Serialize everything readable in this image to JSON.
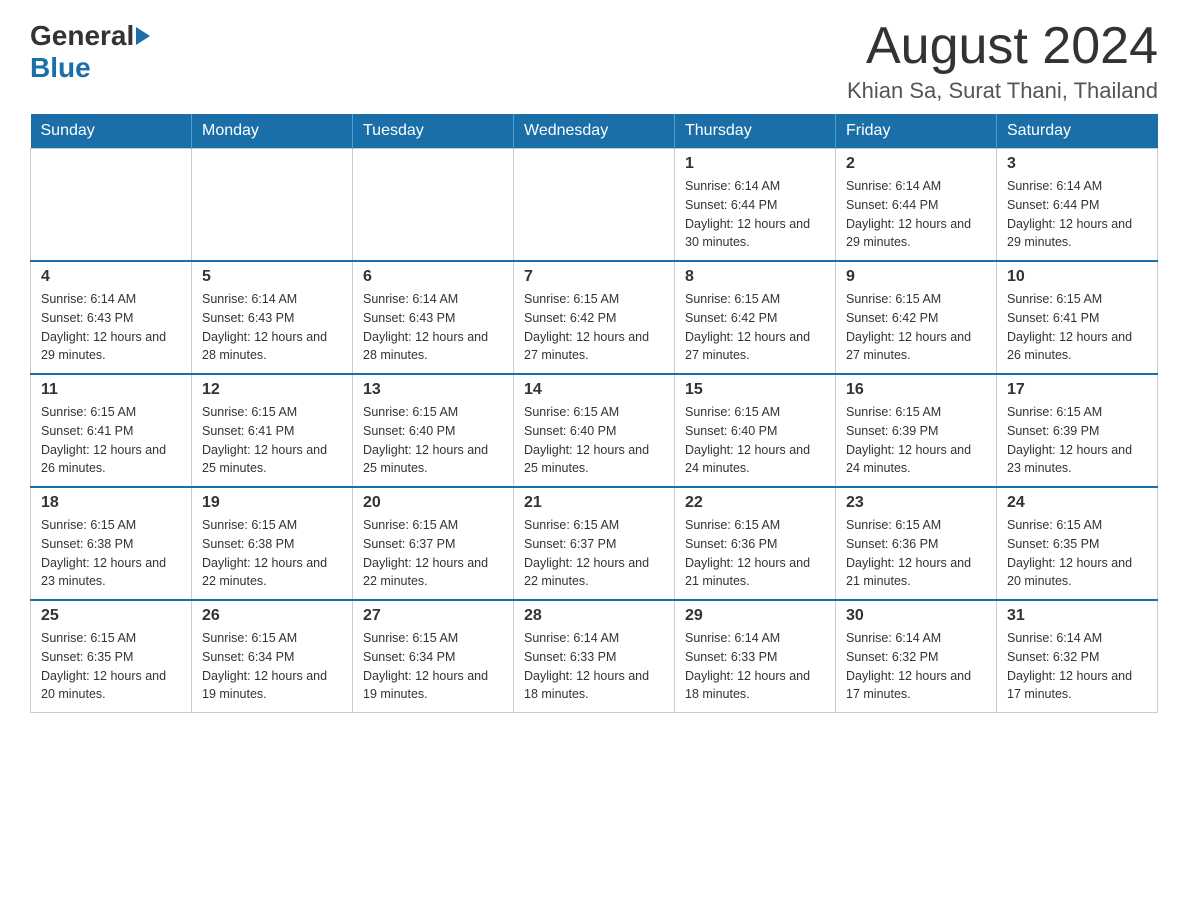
{
  "logo": {
    "general": "General",
    "blue": "Blue"
  },
  "title": "August 2024",
  "location": "Khian Sa, Surat Thani, Thailand",
  "days_of_week": [
    "Sunday",
    "Monday",
    "Tuesday",
    "Wednesday",
    "Thursday",
    "Friday",
    "Saturday"
  ],
  "weeks": [
    [
      {
        "day": "",
        "info": ""
      },
      {
        "day": "",
        "info": ""
      },
      {
        "day": "",
        "info": ""
      },
      {
        "day": "",
        "info": ""
      },
      {
        "day": "1",
        "info": "Sunrise: 6:14 AM\nSunset: 6:44 PM\nDaylight: 12 hours and 30 minutes."
      },
      {
        "day": "2",
        "info": "Sunrise: 6:14 AM\nSunset: 6:44 PM\nDaylight: 12 hours and 29 minutes."
      },
      {
        "day": "3",
        "info": "Sunrise: 6:14 AM\nSunset: 6:44 PM\nDaylight: 12 hours and 29 minutes."
      }
    ],
    [
      {
        "day": "4",
        "info": "Sunrise: 6:14 AM\nSunset: 6:43 PM\nDaylight: 12 hours and 29 minutes."
      },
      {
        "day": "5",
        "info": "Sunrise: 6:14 AM\nSunset: 6:43 PM\nDaylight: 12 hours and 28 minutes."
      },
      {
        "day": "6",
        "info": "Sunrise: 6:14 AM\nSunset: 6:43 PM\nDaylight: 12 hours and 28 minutes."
      },
      {
        "day": "7",
        "info": "Sunrise: 6:15 AM\nSunset: 6:42 PM\nDaylight: 12 hours and 27 minutes."
      },
      {
        "day": "8",
        "info": "Sunrise: 6:15 AM\nSunset: 6:42 PM\nDaylight: 12 hours and 27 minutes."
      },
      {
        "day": "9",
        "info": "Sunrise: 6:15 AM\nSunset: 6:42 PM\nDaylight: 12 hours and 27 minutes."
      },
      {
        "day": "10",
        "info": "Sunrise: 6:15 AM\nSunset: 6:41 PM\nDaylight: 12 hours and 26 minutes."
      }
    ],
    [
      {
        "day": "11",
        "info": "Sunrise: 6:15 AM\nSunset: 6:41 PM\nDaylight: 12 hours and 26 minutes."
      },
      {
        "day": "12",
        "info": "Sunrise: 6:15 AM\nSunset: 6:41 PM\nDaylight: 12 hours and 25 minutes."
      },
      {
        "day": "13",
        "info": "Sunrise: 6:15 AM\nSunset: 6:40 PM\nDaylight: 12 hours and 25 minutes."
      },
      {
        "day": "14",
        "info": "Sunrise: 6:15 AM\nSunset: 6:40 PM\nDaylight: 12 hours and 25 minutes."
      },
      {
        "day": "15",
        "info": "Sunrise: 6:15 AM\nSunset: 6:40 PM\nDaylight: 12 hours and 24 minutes."
      },
      {
        "day": "16",
        "info": "Sunrise: 6:15 AM\nSunset: 6:39 PM\nDaylight: 12 hours and 24 minutes."
      },
      {
        "day": "17",
        "info": "Sunrise: 6:15 AM\nSunset: 6:39 PM\nDaylight: 12 hours and 23 minutes."
      }
    ],
    [
      {
        "day": "18",
        "info": "Sunrise: 6:15 AM\nSunset: 6:38 PM\nDaylight: 12 hours and 23 minutes."
      },
      {
        "day": "19",
        "info": "Sunrise: 6:15 AM\nSunset: 6:38 PM\nDaylight: 12 hours and 22 minutes."
      },
      {
        "day": "20",
        "info": "Sunrise: 6:15 AM\nSunset: 6:37 PM\nDaylight: 12 hours and 22 minutes."
      },
      {
        "day": "21",
        "info": "Sunrise: 6:15 AM\nSunset: 6:37 PM\nDaylight: 12 hours and 22 minutes."
      },
      {
        "day": "22",
        "info": "Sunrise: 6:15 AM\nSunset: 6:36 PM\nDaylight: 12 hours and 21 minutes."
      },
      {
        "day": "23",
        "info": "Sunrise: 6:15 AM\nSunset: 6:36 PM\nDaylight: 12 hours and 21 minutes."
      },
      {
        "day": "24",
        "info": "Sunrise: 6:15 AM\nSunset: 6:35 PM\nDaylight: 12 hours and 20 minutes."
      }
    ],
    [
      {
        "day": "25",
        "info": "Sunrise: 6:15 AM\nSunset: 6:35 PM\nDaylight: 12 hours and 20 minutes."
      },
      {
        "day": "26",
        "info": "Sunrise: 6:15 AM\nSunset: 6:34 PM\nDaylight: 12 hours and 19 minutes."
      },
      {
        "day": "27",
        "info": "Sunrise: 6:15 AM\nSunset: 6:34 PM\nDaylight: 12 hours and 19 minutes."
      },
      {
        "day": "28",
        "info": "Sunrise: 6:14 AM\nSunset: 6:33 PM\nDaylight: 12 hours and 18 minutes."
      },
      {
        "day": "29",
        "info": "Sunrise: 6:14 AM\nSunset: 6:33 PM\nDaylight: 12 hours and 18 minutes."
      },
      {
        "day": "30",
        "info": "Sunrise: 6:14 AM\nSunset: 6:32 PM\nDaylight: 12 hours and 17 minutes."
      },
      {
        "day": "31",
        "info": "Sunrise: 6:14 AM\nSunset: 6:32 PM\nDaylight: 12 hours and 17 minutes."
      }
    ]
  ]
}
